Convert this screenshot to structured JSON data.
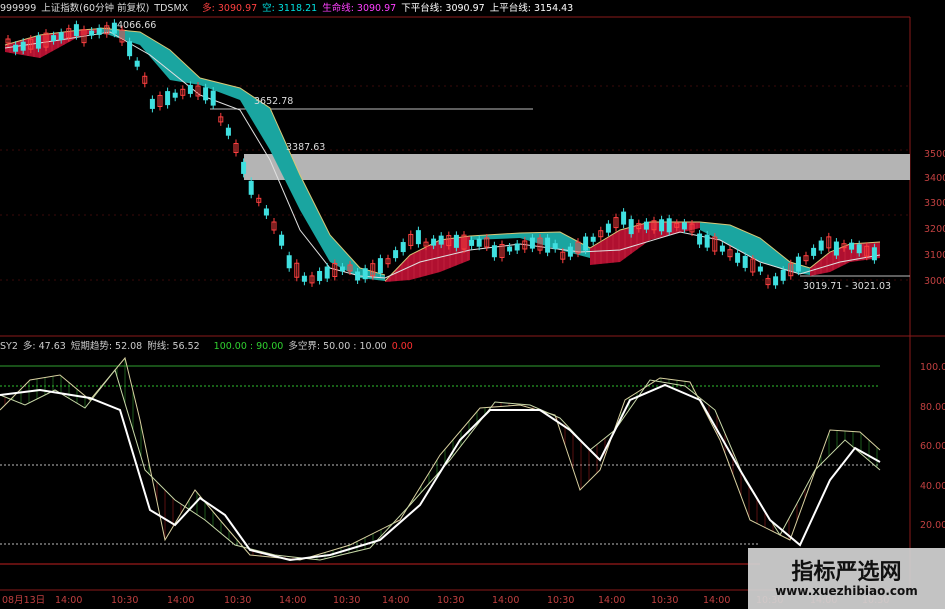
{
  "header": {
    "code": "999999",
    "name": "上证指数(60分钟 前复权)",
    "indicator": "TDSMX",
    "items": [
      {
        "label": "多: 3090.97",
        "color": "#ff4040"
      },
      {
        "label": "空: 3118.21",
        "color": "#00e0e0"
      },
      {
        "label": "生命线: 3090.97",
        "color": "#ff40ff"
      },
      {
        "label": "下平台线: 3090.97",
        "color": "#ffffff"
      },
      {
        "label": "上平台线: 3154.43",
        "color": "#ffffff"
      }
    ]
  },
  "price_panel": {
    "y_ticks": [
      "3500",
      "3400",
      "3300",
      "3200",
      "3100",
      "3000"
    ],
    "annotations": {
      "high": "4066.66",
      "level1": "3652.78",
      "level2": "3387.63",
      "low_range": "3019.71 - 3021.03"
    }
  },
  "indicator_panel": {
    "name": "SY2",
    "items": [
      {
        "label": "多: 47.63",
        "color": "#cccccc"
      },
      {
        "label": "短期趋势: 52.08",
        "color": "#cccccc"
      },
      {
        "label": "附线: 56.52",
        "color": "#cccccc"
      },
      {
        "label": "100.00 : 90.00",
        "color": "#30d030"
      },
      {
        "label": "多空界: 50.00 : 10.00",
        "color": "#cccccc"
      },
      {
        "label": "0.00",
        "color": "#ff3030"
      }
    ],
    "y_ticks": [
      "100.0",
      "80.00",
      "60.00",
      "40.00",
      "20.00"
    ]
  },
  "x_axis": {
    "labels": [
      "08月13日",
      "14:00",
      "10:30",
      "14:00",
      "10:30",
      "14:00",
      "10:30",
      "14:00",
      "10:30",
      "14:00",
      "10:30",
      "14:00",
      "10:30",
      "14:00",
      "10:30",
      "14:00",
      "10:30"
    ]
  },
  "watermark": {
    "title": "指标严选网",
    "url": "www.xuezhibiao.com"
  }
}
